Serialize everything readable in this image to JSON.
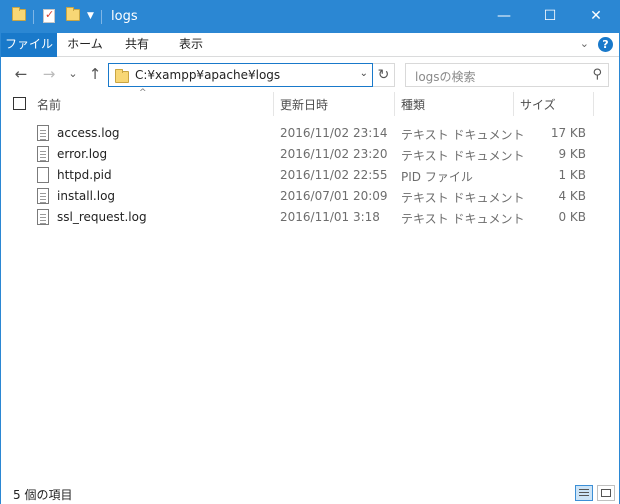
{
  "window": {
    "title": "logs",
    "controls": {
      "minimize": "—",
      "maximize": "☐",
      "close": "✕"
    }
  },
  "ribbon": {
    "tabs": [
      "ファイル",
      "ホーム",
      "共有",
      "表示"
    ],
    "collapse_glyph": "⌄",
    "help_glyph": "?"
  },
  "nav": {
    "back_glyph": "←",
    "forward_glyph": "→",
    "recent_glyph": "⌄",
    "up_glyph": "↑",
    "address": "C:¥xampp¥apache¥logs",
    "refresh_glyph": "↻",
    "search_placeholder": "logsの検索",
    "search_glyph": "⚲"
  },
  "columns": {
    "name": "名前",
    "modified": "更新日時",
    "type": "種類",
    "size": "サイズ",
    "sort_glyph": "^"
  },
  "files": [
    {
      "name": "access.log",
      "modified": "2016/11/02 23:14",
      "type": "テキスト ドキュメント",
      "size": "17 KB",
      "icon": "text-file-icon"
    },
    {
      "name": "error.log",
      "modified": "2016/11/02 23:20",
      "type": "テキスト ドキュメント",
      "size": "9 KB",
      "icon": "text-file-icon"
    },
    {
      "name": "httpd.pid",
      "modified": "2016/11/02 22:55",
      "type": "PID ファイル",
      "size": "1 KB",
      "icon": "blank-file-icon"
    },
    {
      "name": "install.log",
      "modified": "2016/07/01 20:09",
      "type": "テキスト ドキュメント",
      "size": "4 KB",
      "icon": "text-file-icon"
    },
    {
      "name": "ssl_request.log",
      "modified": "2016/11/01 3:18",
      "type": "テキスト ドキュメント",
      "size": "0 KB",
      "icon": "text-file-icon"
    }
  ],
  "status": {
    "item_count": "5 個の項目"
  },
  "colors": {
    "titlebar": "#2b87d3",
    "file_tab": "#1979ca",
    "address_border": "#1979ca"
  }
}
